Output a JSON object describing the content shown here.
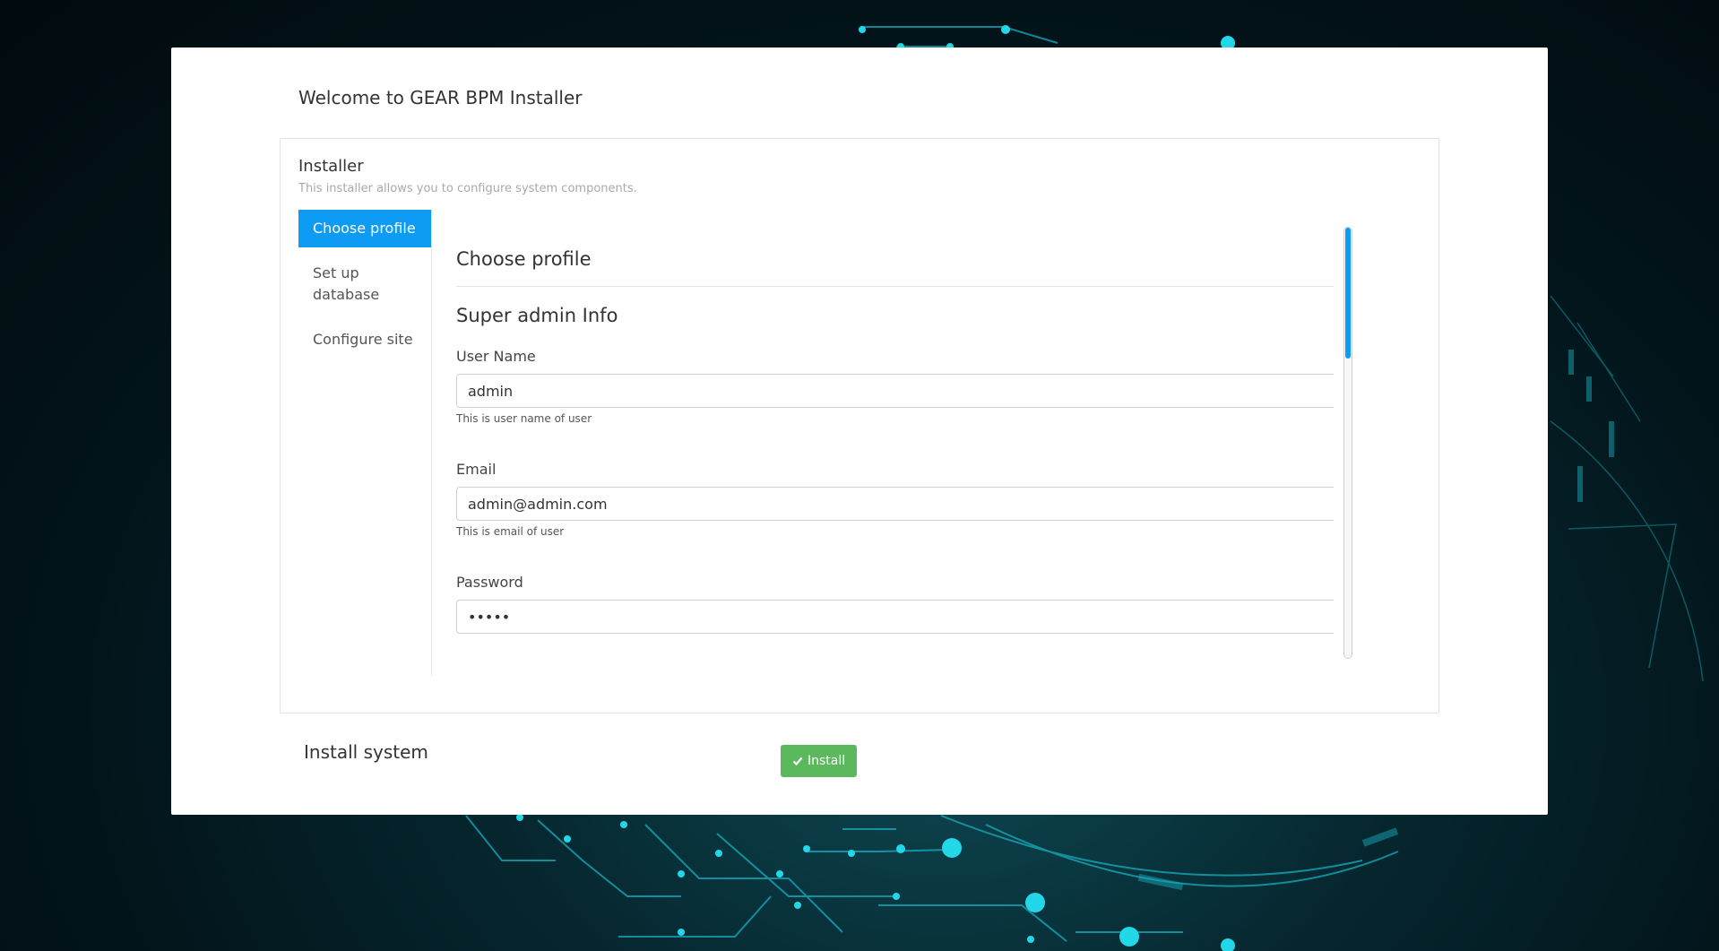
{
  "header": {
    "welcome": "Welcome to GEAR BPM Installer"
  },
  "installer": {
    "title": "Installer",
    "subtitle": "This installer allows you to configure system components."
  },
  "steps": [
    {
      "label": "Choose profile",
      "active": true
    },
    {
      "label": "Set up database",
      "active": false
    },
    {
      "label": "Configure site",
      "active": false
    }
  ],
  "content": {
    "section_title": "Choose profile",
    "subsection_title": "Super admin Info",
    "fields": {
      "username": {
        "label": "User Name",
        "value": "admin",
        "help": "This is user name of user"
      },
      "email": {
        "label": "Email",
        "value": "admin@admin.com",
        "help": "This is email of user"
      },
      "password": {
        "label": "Password",
        "value": "•••••"
      }
    }
  },
  "footer": {
    "install_title": "Install system",
    "install_button": "Install",
    "install_icon": "check-icon"
  },
  "colors": {
    "accent": "#0e9bf3",
    "success": "#5cb85c"
  }
}
